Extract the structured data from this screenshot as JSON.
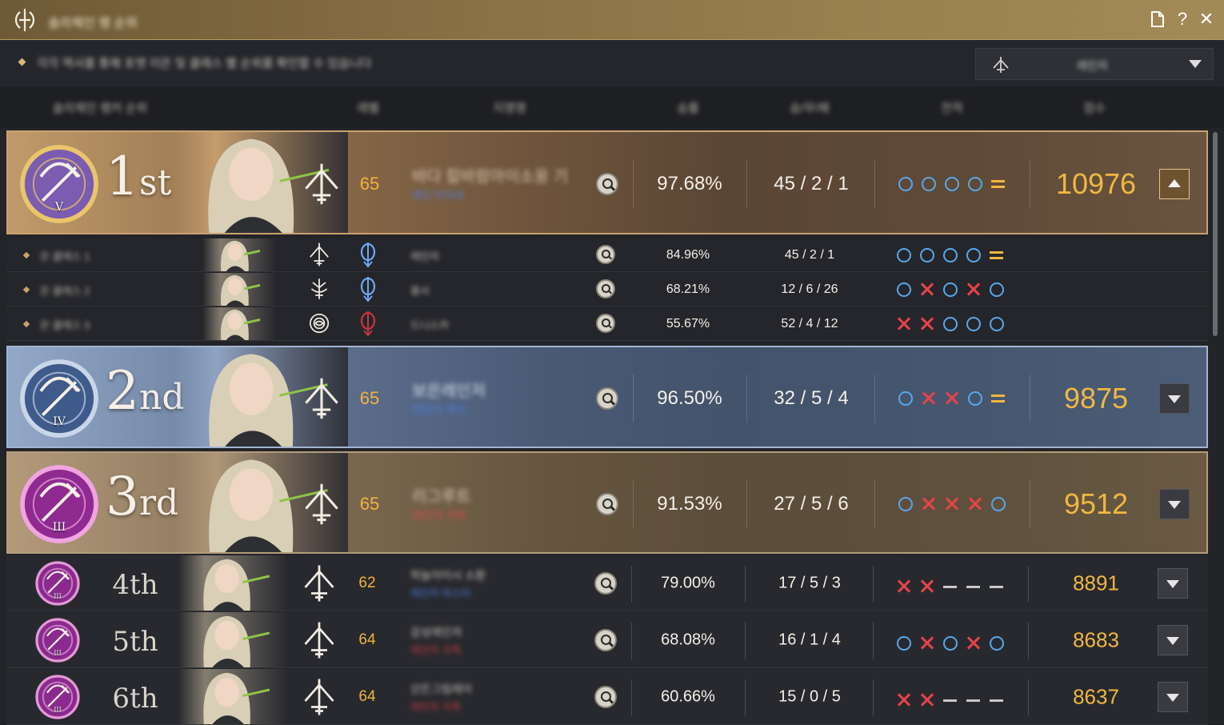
{
  "window": {
    "title": "솔라체인 랭 순위",
    "icons": {
      "logo": "tower-logo-icon",
      "memo": "document-icon",
      "help": "?",
      "close": "✕"
    }
  },
  "subheader": {
    "hint": "각각 역사를 통해 포맷 이은 및 클래스 별 순위를 확인할 수 있습니다",
    "filter": {
      "value": "레인저",
      "icon": "ranger-class-icon"
    }
  },
  "columns": [
    "솔라체인 랭커 순위",
    "레벨",
    "지명명",
    "승률",
    "승/무/패",
    "전적",
    "점수"
  ],
  "colors": {
    "accent": "#f1b840",
    "win": "#58a7ea",
    "loss": "#e8434a",
    "draw": "#f2b63f"
  },
  "top": [
    {
      "rank": "1",
      "suffix": "st",
      "tier_roman": "V",
      "class_icon": "ranger-class-icon",
      "level": "65",
      "name": "바다 칼바람아이소옹 기",
      "guild": "레드가이네",
      "winrate": "97.68%",
      "record": "45 / 2 / 1",
      "results": [
        "o",
        "o",
        "o",
        "o",
        "="
      ],
      "score": "10976",
      "expanded": true,
      "members": [
        {
          "name": "은 클레스 1",
          "class_icon": "ranger-class-icon",
          "crest_icon": "blue-crest-icon",
          "guild": "레인저",
          "winrate": "84.96%",
          "record": "45 / 2 / 1",
          "results": [
            "o",
            "o",
            "o",
            "o",
            "="
          ]
        },
        {
          "name": "은 클레스 2",
          "class_icon": "warrior-class-icon",
          "crest_icon": "blue-crest-icon",
          "guild": "용사",
          "winrate": "68.21%",
          "record": "12 / 6 / 26",
          "results": [
            "o",
            "x",
            "o",
            "x",
            "o"
          ]
        },
        {
          "name": "은 클레스 3",
          "class_icon": "rose-class-icon",
          "crest_icon": "red-crest-icon",
          "guild": "드니스카",
          "winrate": "55.67%",
          "record": "52 / 4 / 12",
          "results": [
            "x",
            "x",
            "o",
            "o",
            "o"
          ]
        }
      ]
    },
    {
      "rank": "2",
      "suffix": "nd",
      "tier_roman": "IV",
      "class_icon": "ranger-class-icon",
      "level": "65",
      "name": "보은레인저",
      "guild": "레인저 메서",
      "winrate": "96.50%",
      "record": "32 / 5 / 4",
      "results": [
        "o",
        "x",
        "x",
        "o",
        "="
      ],
      "score": "9875",
      "expanded": false
    },
    {
      "rank": "3",
      "suffix": "rd",
      "tier_roman": "III",
      "class_icon": "ranger-class-icon",
      "level": "65",
      "name": "리그루트",
      "guild": "레인저 귀족",
      "winrate": "91.53%",
      "record": "27 / 5 / 6",
      "results": [
        "o",
        "x",
        "x",
        "x",
        "o"
      ],
      "score": "9512",
      "expanded": false
    }
  ],
  "others": [
    {
      "rank": "4th",
      "level": "62",
      "name": "하늘아이시 소환",
      "guild": "레인저 마스터",
      "winrate": "79.00%",
      "record": "17 / 5 / 3",
      "results": [
        "x",
        "x",
        "-",
        "-",
        "-"
      ],
      "score": "8891",
      "class_icon": "ranger-class-icon",
      "tier_roman": "III"
    },
    {
      "rank": "5th",
      "level": "64",
      "name": "감성레인저",
      "guild": "레인저 귀족",
      "winrate": "68.08%",
      "record": "16 / 1 / 4",
      "results": [
        "o",
        "x",
        "o",
        "x",
        "o"
      ],
      "score": "8683",
      "class_icon": "ranger-class-icon",
      "tier_roman": "III"
    },
    {
      "rank": "6th",
      "level": "64",
      "name": "산든그림레이",
      "guild": "레인저 귀족",
      "winrate": "60.66%",
      "record": "15 / 0 / 5",
      "results": [
        "x",
        "x",
        "-",
        "-",
        "-"
      ],
      "score": "8637",
      "class_icon": "ranger-class-icon",
      "tier_roman": "III"
    }
  ]
}
